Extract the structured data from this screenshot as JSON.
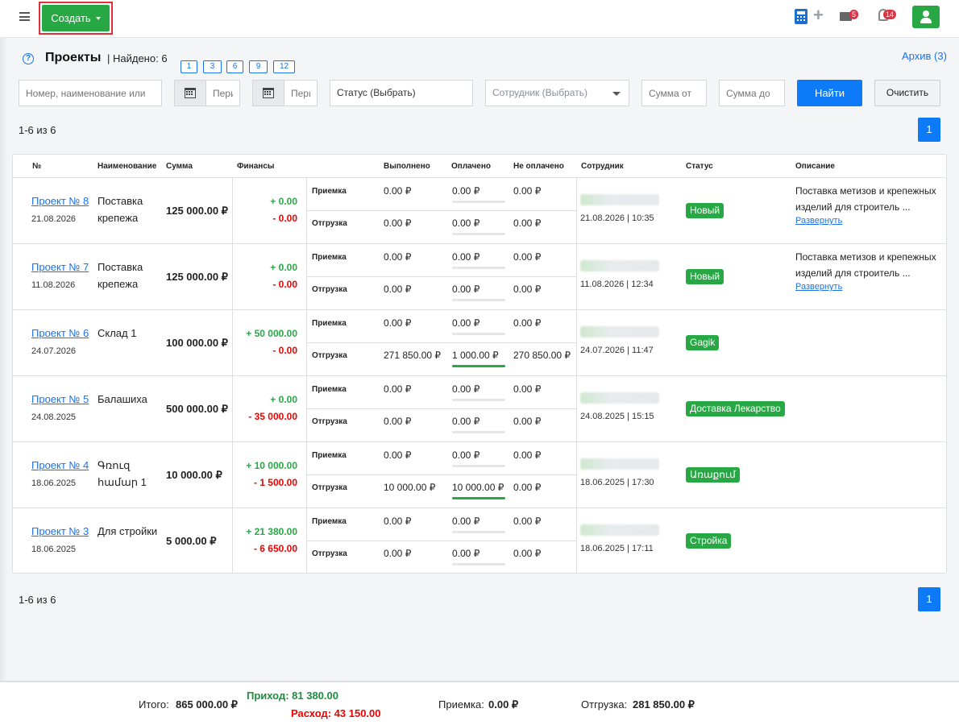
{
  "topbar": {
    "create_label": "Создать",
    "messages_count": "5",
    "notifications_count": "14"
  },
  "header": {
    "title": "Проекты",
    "found": "| Найдено: 6",
    "perpage": [
      "1",
      "3",
      "6",
      "9",
      "12"
    ],
    "archive": "Архив (3)"
  },
  "filters": {
    "search_placeholder": "Номер, наименование или",
    "period1_placeholder": "Период",
    "period2_placeholder": "Период",
    "status_placeholder": "Статус (Выбрать)",
    "employee_placeholder": "Сотрудник (Выбрать)",
    "sum_from_placeholder": "Сумма от",
    "sum_to_placeholder": "Сумма до",
    "find": "Найти",
    "clear": "Очистить"
  },
  "pagination": {
    "counter": "1-6 из 6",
    "page": "1"
  },
  "table": {
    "headers": [
      "№",
      "Наименование",
      "Сумма",
      "Финансы",
      "Выполнено",
      "Оплачено",
      "Не оплачено",
      "Сотрудник",
      "Статус",
      "Описание"
    ],
    "op_labels": {
      "accept": "Приемка",
      "ship": "Отгрузка"
    },
    "rows": [
      {
        "num": "Проект № 8",
        "date": "21.08.2026",
        "name": "Поставка крепежа",
        "sum": "125 000.00 ₽",
        "fin_plus": "+ 0.00",
        "fin_minus": "- 0.00",
        "accept": {
          "done": "0.00 ₽",
          "paid": "0.00 ₽",
          "unpaid": "0.00 ₽"
        },
        "ship": {
          "done": "0.00 ₽",
          "paid": "0.00 ₽",
          "unpaid": "0.00 ₽"
        },
        "emp_date": "21.08.2026 | 10:35",
        "status": "Новый",
        "desc": "Поставка метизов и крепежных изделий для строитель ...",
        "expand": "Развернуть"
      },
      {
        "num": "Проект № 7",
        "date": "11.08.2026",
        "name": "Поставка крепежа",
        "sum": "125 000.00 ₽",
        "fin_plus": "+ 0.00",
        "fin_minus": "- 0.00",
        "accept": {
          "done": "0.00 ₽",
          "paid": "0.00 ₽",
          "unpaid": "0.00 ₽"
        },
        "ship": {
          "done": "0.00 ₽",
          "paid": "0.00 ₽",
          "unpaid": "0.00 ₽"
        },
        "emp_date": "11.08.2026 | 12:34",
        "status": "Новый",
        "desc": "Поставка метизов и крепежных изделий для строитель ...",
        "expand": "Развернуть"
      },
      {
        "num": "Проект № 6",
        "date": "24.07.2026",
        "name": "Склад 1",
        "sum": "100 000.00 ₽",
        "fin_plus": "+ 50 000.00",
        "fin_minus": "- 0.00",
        "accept": {
          "done": "0.00 ₽",
          "paid": "0.00 ₽",
          "unpaid": "0.00 ₽"
        },
        "ship": {
          "done": "271 850.00 ₽",
          "paid": "1 000.00 ₽",
          "unpaid": "270 850.00 ₽"
        },
        "emp_date": "24.07.2026 | 11:47",
        "status": "Gagik",
        "desc": "",
        "expand": ""
      },
      {
        "num": "Проект № 5",
        "date": "24.08.2025",
        "name": "Балашиха",
        "sum": "500 000.00 ₽",
        "fin_plus": "+ 0.00",
        "fin_minus": "- 35 000.00",
        "accept": {
          "done": "0.00 ₽",
          "paid": "0.00 ₽",
          "unpaid": "0.00 ₽"
        },
        "ship": {
          "done": "0.00 ₽",
          "paid": "0.00 ₽",
          "unpaid": "0.00 ₽"
        },
        "emp_date": "24.08.2025 | 15:15",
        "status": "Доставка Лекарство",
        "desc": "",
        "expand": ""
      },
      {
        "num": "Проект № 4",
        "date": "18.06.2025",
        "name": "Գռուզ համար 1",
        "sum": "10 000.00 ₽",
        "fin_plus": "+ 10 000.00",
        "fin_minus": "- 1 500.00",
        "accept": {
          "done": "0.00 ₽",
          "paid": "0.00 ₽",
          "unpaid": "0.00 ₽"
        },
        "ship": {
          "done": "10 000.00 ₽",
          "paid": "10 000.00 ₽",
          "unpaid": "0.00 ₽"
        },
        "emp_date": "18.06.2025 | 17:30",
        "status": "Առաքում",
        "desc": "",
        "expand": ""
      },
      {
        "num": "Проект № 3",
        "date": "18.06.2025",
        "name": "Для стройки",
        "sum": "5 000.00 ₽",
        "fin_plus": "+ 21 380.00",
        "fin_minus": "- 6 650.00",
        "accept": {
          "done": "0.00 ₽",
          "paid": "0.00 ₽",
          "unpaid": "0.00 ₽"
        },
        "ship": {
          "done": "0.00 ₽",
          "paid": "0.00 ₽",
          "unpaid": "0.00 ₽"
        },
        "emp_date": "18.06.2025 | 17:11",
        "status": "Стройка",
        "desc": "",
        "expand": ""
      }
    ]
  },
  "footer": {
    "total_label": "Итого:",
    "total_value": "865 000.00 ₽",
    "income": "Приход: 81 380.00",
    "expense": "Расход: 43 150.00",
    "accept_label": "Приемка:",
    "accept_value": "0.00 ₽",
    "ship_label": "Отгрузка:",
    "ship_value": "281 850.00 ₽"
  },
  "colors": {
    "accent": "#0d7bf7",
    "success": "#28a745",
    "danger": "#e00000"
  }
}
